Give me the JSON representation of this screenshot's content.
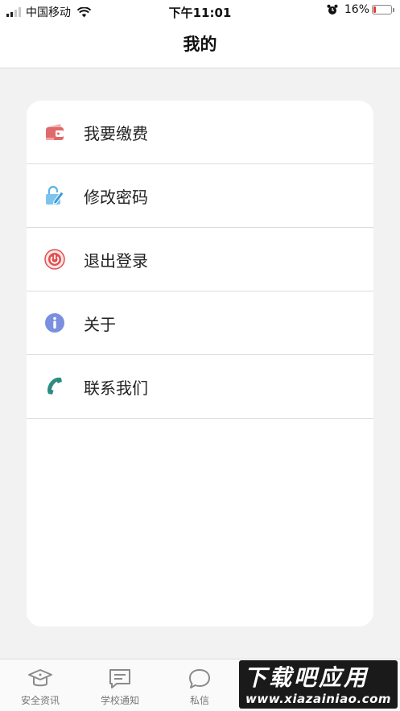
{
  "status_bar": {
    "carrier": "中国移动",
    "time": "下午11:01",
    "battery_percent": "16%",
    "battery_level": 0.16,
    "icons": [
      "signal-icon",
      "wifi-icon",
      "alarm-icon",
      "battery-icon"
    ]
  },
  "header": {
    "title": "我的"
  },
  "menu": {
    "items": [
      {
        "label": "我要缴费",
        "icon": "wallet-icon",
        "color": "#e06a6a"
      },
      {
        "label": "修改密码",
        "icon": "lock-edit-icon",
        "color": "#5ab4e8"
      },
      {
        "label": "退出登录",
        "icon": "logout-icon",
        "color": "#e05050"
      },
      {
        "label": "关于",
        "icon": "info-icon",
        "color": "#7b8fe0"
      },
      {
        "label": "联系我们",
        "icon": "phone-icon",
        "color": "#2e8b82"
      }
    ]
  },
  "tab_bar": {
    "tabs": [
      {
        "label": "安全资讯",
        "icon": "graduation-cap-icon"
      },
      {
        "label": "学校通知",
        "icon": "message-square-icon"
      },
      {
        "label": "私信",
        "icon": "chat-bubble-icon"
      }
    ]
  },
  "watermark": {
    "title": "下载吧应用",
    "url": "www.xiazainiao.com"
  }
}
